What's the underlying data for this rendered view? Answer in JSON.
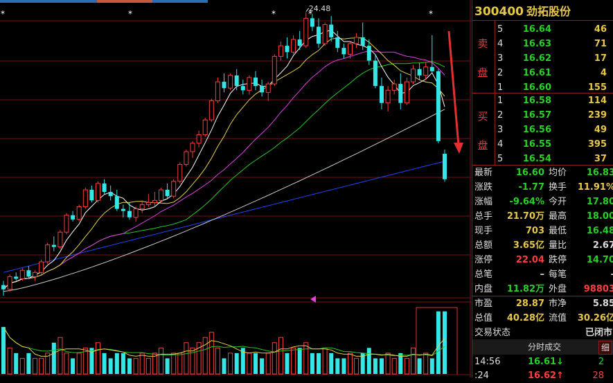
{
  "stock": {
    "code": "300400",
    "name": "劲拓股份"
  },
  "chart": {
    "high_label": "24.48",
    "markers": [
      "*",
      "*",
      "*",
      "*",
      "*"
    ]
  },
  "orderbook": {
    "sell_label_1": "卖",
    "sell_label_2": "盘",
    "buy_label_1": "买",
    "buy_label_2": "盘",
    "sell": [
      {
        "level": "5",
        "price": "16.64",
        "vol": "46"
      },
      {
        "level": "4",
        "price": "16.63",
        "vol": "71"
      },
      {
        "level": "3",
        "price": "16.62",
        "vol": "17"
      },
      {
        "level": "2",
        "price": "16.61",
        "vol": "4"
      },
      {
        "level": "1",
        "price": "16.60",
        "vol": "155"
      }
    ],
    "buy": [
      {
        "level": "1",
        "price": "16.58",
        "vol": "114"
      },
      {
        "level": "2",
        "price": "16.57",
        "vol": "239"
      },
      {
        "level": "3",
        "price": "16.56",
        "vol": "49"
      },
      {
        "level": "4",
        "price": "16.55",
        "vol": "395"
      },
      {
        "level": "5",
        "price": "16.54",
        "vol": "37"
      }
    ]
  },
  "stats": [
    {
      "l1": "最新",
      "v1": "16.60",
      "c1": "green",
      "l2": "均价",
      "v2": "16.83",
      "c2": "green"
    },
    {
      "l1": "涨跌",
      "v1": "-1.77",
      "c1": "green",
      "l2": "换手",
      "v2": "11.91%",
      "c2": "yellow"
    },
    {
      "l1": "涨幅",
      "v1": "-9.64%",
      "c1": "green",
      "l2": "今开",
      "v2": "17.80",
      "c2": "green"
    },
    {
      "l1": "总手",
      "v1": "21.70万",
      "c1": "yellow",
      "l2": "最高",
      "v2": "18.00",
      "c2": "green"
    },
    {
      "l1": "现手",
      "v1": "703",
      "c1": "yellow",
      "l2": "最低",
      "v2": "16.48",
      "c2": "green"
    },
    {
      "l1": "总额",
      "v1": "3.65亿",
      "c1": "yellow",
      "l2": "量比",
      "v2": "2.67",
      "c2": "white"
    },
    {
      "l1": "涨停",
      "v1": "22.04",
      "c1": "red",
      "l2": "跌停",
      "v2": "14.70",
      "c2": "green"
    },
    {
      "l1": "总笔",
      "v1": "–",
      "c1": "white",
      "l2": "每笔",
      "v2": "–",
      "c2": "white"
    },
    {
      "l1": "内盘",
      "v1": "11.82万",
      "c1": "green",
      "l2": "外盘",
      "v2": "98803",
      "c2": "red"
    }
  ],
  "valuation": [
    {
      "l1": "市盈",
      "v1": "28.87",
      "c1": "yellow",
      "l2": "市净",
      "v2": "5.85",
      "c2": "white"
    },
    {
      "l1": "总值",
      "v1": "40.28亿",
      "c1": "yellow",
      "l2": "流值",
      "v2": "30.26亿",
      "c2": "yellow"
    }
  ],
  "trade_state": {
    "label": "交易状态",
    "value": "已闭市"
  },
  "trades": {
    "header": "分时成交",
    "detail_btn": "细",
    "rows": [
      {
        "time": "14:56",
        "price": "16.61",
        "arrow": "↓",
        "color": "green",
        "vol": "2"
      },
      {
        "time": ":24",
        "price": "16.62",
        "arrow": "↑",
        "color": "red",
        "vol": "28"
      }
    ]
  },
  "colors": {
    "up": "#ff3d3d",
    "down": "#34e6e6",
    "ma5": "#ffffff",
    "ma10": "#e6d24a",
    "ma20": "#e040e0",
    "ma30": "#27c727",
    "ma60": "#cccccc",
    "ma120": "#2244ff",
    "grid": "#7a1515"
  },
  "candles": [
    [
      11.6,
      11.8,
      11.1,
      11.4
    ],
    [
      11.4,
      12.1,
      11.3,
      12.0
    ],
    [
      12.0,
      12.2,
      11.8,
      11.9
    ],
    [
      11.9,
      12.4,
      11.8,
      12.3
    ],
    [
      12.3,
      12.5,
      11.9,
      12.0
    ],
    [
      12.0,
      12.3,
      11.8,
      12.2
    ],
    [
      12.2,
      12.8,
      12.1,
      12.7
    ],
    [
      12.7,
      13.6,
      12.6,
      13.5
    ],
    [
      13.5,
      13.9,
      13.2,
      13.4
    ],
    [
      13.4,
      14.2,
      13.3,
      14.1
    ],
    [
      14.1,
      15.0,
      14.0,
      14.9
    ],
    [
      14.9,
      15.1,
      14.6,
      14.7
    ],
    [
      14.7,
      15.4,
      14.6,
      15.3
    ],
    [
      15.3,
      16.2,
      15.2,
      16.1
    ],
    [
      16.1,
      16.3,
      15.5,
      15.6
    ],
    [
      15.6,
      16.5,
      15.5,
      16.4
    ],
    [
      16.4,
      16.6,
      15.9,
      16.0
    ],
    [
      16.0,
      16.3,
      15.6,
      15.8
    ],
    [
      15.8,
      16.1,
      15.1,
      15.2
    ],
    [
      15.2,
      15.4,
      14.8,
      15.1
    ],
    [
      15.1,
      15.5,
      14.7,
      14.8
    ],
    [
      14.8,
      15.3,
      14.6,
      15.2
    ],
    [
      15.2,
      15.6,
      15.0,
      15.4
    ],
    [
      15.4,
      15.9,
      15.3,
      15.5
    ],
    [
      15.5,
      16.0,
      15.3,
      15.6
    ],
    [
      15.6,
      16.2,
      15.5,
      16.1
    ],
    [
      16.1,
      16.4,
      15.7,
      15.8
    ],
    [
      15.8,
      16.6,
      15.7,
      16.5
    ],
    [
      16.5,
      17.4,
      16.4,
      17.3
    ],
    [
      17.3,
      18.0,
      17.2,
      17.9
    ],
    [
      17.9,
      18.4,
      17.6,
      18.3
    ],
    [
      18.3,
      18.9,
      18.1,
      18.7
    ],
    [
      18.7,
      19.5,
      18.6,
      19.4
    ],
    [
      19.4,
      20.4,
      19.3,
      20.3
    ],
    [
      20.3,
      21.4,
      20.2,
      21.2
    ],
    [
      21.2,
      21.6,
      20.7,
      20.9
    ],
    [
      20.9,
      21.6,
      20.8,
      21.5
    ],
    [
      21.5,
      21.8,
      20.8,
      21.0
    ],
    [
      21.0,
      21.3,
      20.6,
      20.8
    ],
    [
      20.8,
      21.5,
      20.6,
      21.4
    ],
    [
      21.4,
      21.7,
      20.8,
      21.0
    ],
    [
      21.0,
      21.3,
      20.5,
      20.7
    ],
    [
      20.7,
      21.2,
      20.3,
      21.1
    ],
    [
      21.1,
      22.5,
      21.0,
      22.4
    ],
    [
      22.4,
      23.1,
      22.2,
      22.9
    ],
    [
      22.9,
      23.3,
      22.3,
      22.6
    ],
    [
      22.6,
      23.4,
      22.5,
      23.2
    ],
    [
      23.2,
      23.6,
      22.7,
      22.9
    ],
    [
      22.9,
      24.48,
      22.8,
      24.2
    ],
    [
      24.2,
      24.4,
      23.6,
      23.8
    ],
    [
      23.8,
      24.2,
      22.8,
      23.0
    ],
    [
      23.0,
      24.0,
      22.9,
      23.9
    ],
    [
      23.9,
      24.3,
      23.1,
      23.3
    ],
    [
      23.3,
      23.6,
      22.6,
      22.8
    ],
    [
      22.8,
      23.0,
      22.3,
      22.5
    ],
    [
      22.5,
      23.1,
      22.3,
      23.0
    ],
    [
      23.0,
      23.5,
      22.8,
      23.3
    ],
    [
      23.3,
      24.0,
      22.7,
      22.9
    ],
    [
      22.9,
      23.2,
      22.0,
      22.2
    ],
    [
      22.2,
      22.5,
      20.9,
      21.0
    ],
    [
      21.0,
      21.4,
      19.9,
      20.2
    ],
    [
      20.2,
      21.0,
      19.8,
      20.8
    ],
    [
      20.8,
      21.3,
      20.6,
      21.1
    ],
    [
      21.1,
      21.6,
      19.9,
      20.2
    ],
    [
      20.2,
      21.4,
      20.1,
      21.2
    ],
    [
      21.2,
      22.0,
      21.1,
      21.8
    ],
    [
      21.8,
      22.1,
      21.3,
      21.5
    ],
    [
      21.5,
      22.1,
      21.3,
      21.9
    ],
    [
      21.9,
      23.4,
      21.6,
      21.7
    ],
    [
      21.7,
      21.8,
      18.3,
      18.4
    ],
    [
      17.8,
      18.0,
      16.48,
      16.6
    ]
  ],
  "volumes": [
    9,
    5,
    4,
    3,
    4,
    3,
    3,
    4,
    6,
    7,
    4,
    3,
    4,
    5,
    5,
    6,
    4,
    3,
    4,
    4,
    3,
    3,
    4,
    3,
    4,
    5,
    3,
    4,
    4,
    6,
    5,
    6,
    7,
    8,
    5,
    3,
    4,
    4,
    5,
    4,
    4,
    3,
    4,
    6,
    7,
    4,
    5,
    5,
    6,
    4,
    4,
    5,
    4,
    3,
    3,
    4,
    3,
    4,
    5,
    3,
    3,
    4,
    3,
    4,
    3,
    5,
    3,
    4,
    3,
    12,
    12
  ]
}
